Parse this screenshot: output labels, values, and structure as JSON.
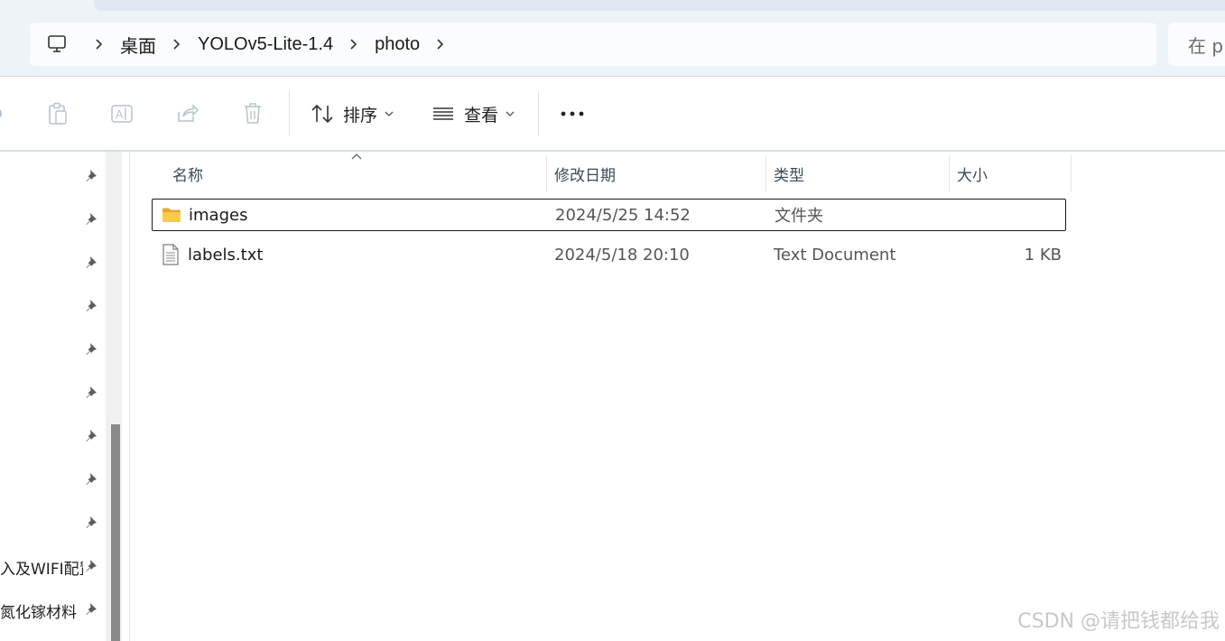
{
  "address": {
    "breadcrumbs": [
      {
        "label": "桌面"
      },
      {
        "label": "YOLOv5-Lite-1.4"
      },
      {
        "label": "photo"
      }
    ],
    "search_placeholder": "在 p"
  },
  "toolbar": {
    "sort_label": "排序",
    "view_label": "查看"
  },
  "nav": {
    "items": [
      {
        "label": ""
      },
      {
        "label": ""
      },
      {
        "label": ""
      },
      {
        "label": ""
      },
      {
        "label": ""
      },
      {
        "label": ""
      },
      {
        "label": ""
      },
      {
        "label": ""
      },
      {
        "label": ""
      },
      {
        "label": "入及WIFI配置"
      },
      {
        "label": "氮化镓材料"
      }
    ]
  },
  "list": {
    "columns": {
      "name": "名称",
      "date": "修改日期",
      "type": "类型",
      "size": "大小"
    },
    "rows": [
      {
        "name": "images",
        "date": "2024/5/25 14:52",
        "type": "文件夹",
        "size": "",
        "kind": "folder"
      },
      {
        "name": "labels.txt",
        "date": "2024/5/18 20:10",
        "type": "Text Document",
        "size": "1 KB",
        "kind": "text"
      }
    ]
  },
  "watermark": "CSDN @请把钱都给我",
  "colors": {
    "folder": "#f5c242",
    "accent_border": "#1a1a1a",
    "header_text": "#3b4a5a"
  }
}
